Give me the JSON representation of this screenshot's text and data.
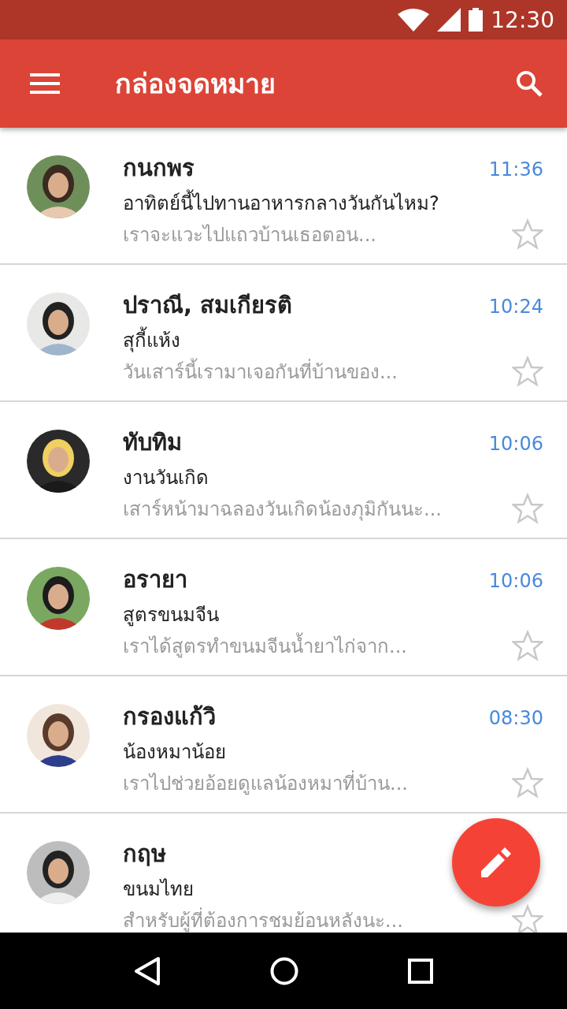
{
  "status_bar": {
    "time": "12:30"
  },
  "app_bar": {
    "title": "กล่องจดหมาย"
  },
  "messages": [
    {
      "sender": "กนกพร",
      "subject": "อาทิตย์นี้ไปทานอาหารกลางวันกันไหม?",
      "preview": "เราจะแวะไปแถวบ้านเธอตอน...",
      "time": "11:36",
      "starred": false
    },
    {
      "sender": "ปราณี, สมเกียรติ",
      "subject": "สุกี้แห้ง",
      "preview": "วันเสาร์นี้เรามาเจอกันที่บ้านของ...",
      "time": "10:24",
      "starred": false
    },
    {
      "sender": "ทับทิม",
      "subject": "งานวันเกิด",
      "preview": "เสาร์หน้ามาฉลองวันเกิดน้องภุมิกันนะ...",
      "time": "10:06",
      "starred": false
    },
    {
      "sender": "อรายา",
      "subject": "สูตรขนมจีน",
      "preview": "เราได้สูตรทำขนมจีนน้ำยาไก่จาก...",
      "time": "10:06",
      "starred": false
    },
    {
      "sender": "กรองแก้วิ",
      "subject": "น้องหมาน้อย",
      "preview": "เราไปช่วยอ้อยดูแลน้องหมาที่บ้าน...",
      "time": "08:30",
      "starred": false
    },
    {
      "sender": "กฤษ",
      "subject": "ขนมไทย",
      "preview": "สำหรับผู้ที่ต้องการชมย้อนหลังนะ...",
      "starred": false
    }
  ]
}
